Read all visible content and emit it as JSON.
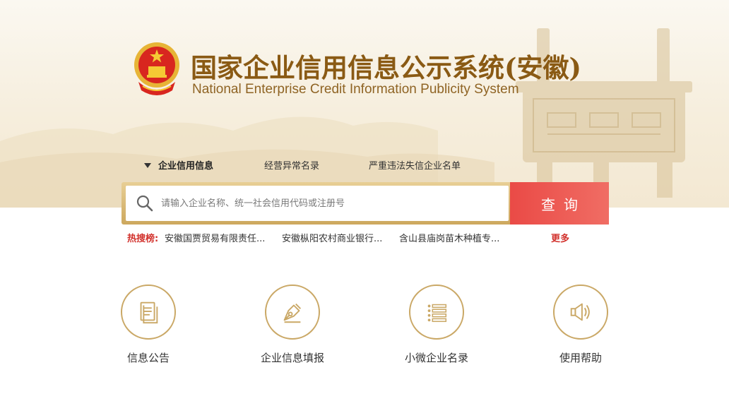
{
  "header": {
    "title": "国家企业信用信息公示系统(安徽)",
    "subtitle": "National Enterprise Credit Information Publicity System"
  },
  "tabs": [
    {
      "label": "企业信用信息",
      "active": true
    },
    {
      "label": "经营异常名录",
      "active": false
    },
    {
      "label": "严重违法失信企业名单",
      "active": false
    }
  ],
  "search": {
    "placeholder": "请输入企业名称、统一社会信用代码或注册号",
    "value": "",
    "button_label": "查询"
  },
  "hot_search": {
    "label": "热搜榜:",
    "items": [
      "安徽国贾贸易有限责任...",
      "安徽枞阳农村商业银行...",
      "含山县庙岗苗木种植专..."
    ],
    "more_label": "更多"
  },
  "features": [
    {
      "label": "信息公告",
      "icon": "document-icon"
    },
    {
      "label": "企业信息填报",
      "icon": "pen-nib-icon"
    },
    {
      "label": "小微企业名录",
      "icon": "list-icon"
    },
    {
      "label": "使用帮助",
      "icon": "speaker-icon"
    }
  ],
  "colors": {
    "brand_gold": "#8a5a14",
    "accent_red": "#ea4a46",
    "icon_gold": "#caa866"
  }
}
